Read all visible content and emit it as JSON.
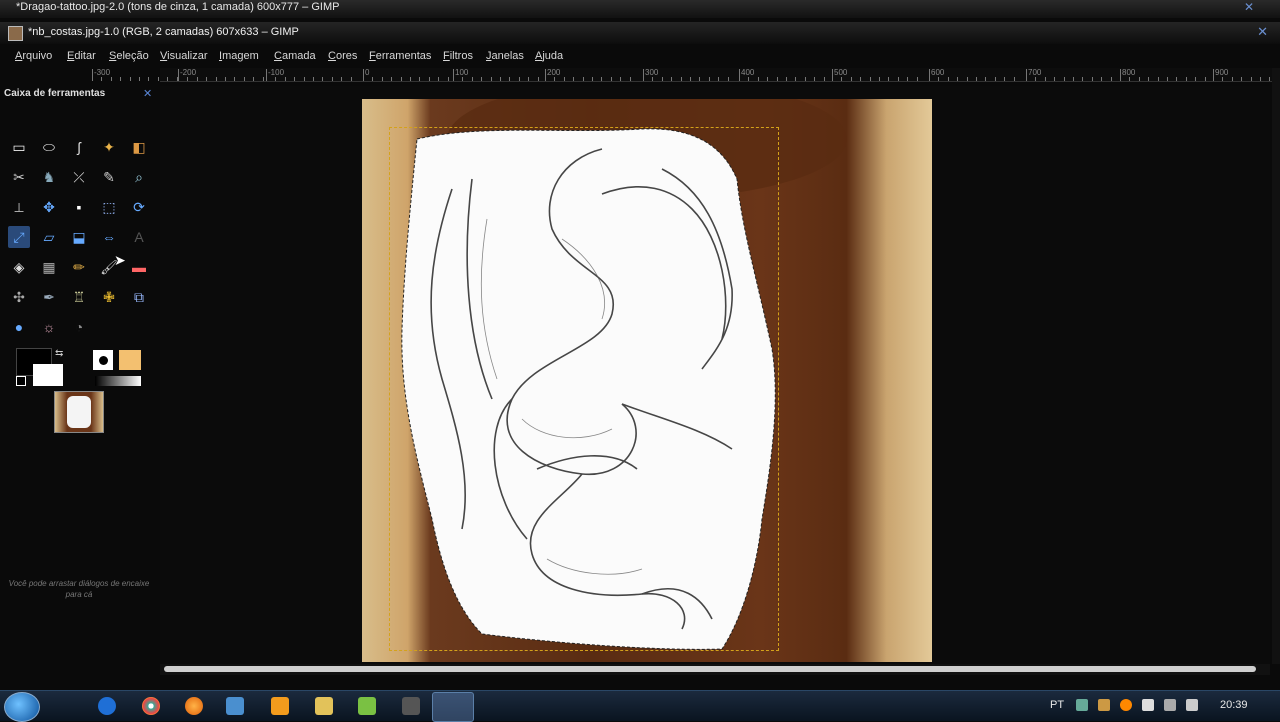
{
  "background_window": {
    "title": "*Dragao-tattoo.jpg-2.0 (tons de cinza, 1 camada) 600x777 – GIMP"
  },
  "window": {
    "title": "*nb_costas.jpg-1.0 (RGB, 2 camadas) 607x633 – GIMP"
  },
  "menu": [
    "Arquivo",
    "Editar",
    "Seleção",
    "Visualizar",
    "Imagem",
    "Camada",
    "Cores",
    "Ferramentas",
    "Filtros",
    "Janelas",
    "Ajuda"
  ],
  "ruler_labels": [
    "-300",
    "-200",
    "-100",
    "0",
    "100",
    "200",
    "300",
    "400",
    "500",
    "600",
    "700",
    "800",
    "900"
  ],
  "toolbox": {
    "title": "Caixa de ferramentas",
    "hint": "Você pode arrastar diálogos de encaixe para cá",
    "tools": [
      "rect-select-icon",
      "ellipse-select-icon",
      "free-select-icon",
      "fuzzy-select-icon",
      "color-select-icon",
      "scissors-select-icon",
      "foreground-select-icon",
      "paths-icon",
      "color-picker-icon",
      "zoom-icon",
      "measure-icon",
      "move-icon",
      "align-icon",
      "crop-icon",
      "rotate-icon",
      "scale-icon",
      "shear-icon",
      "perspective-icon",
      "flip-icon",
      "text-icon",
      "bucket-fill-icon",
      "blend-icon",
      "pencil-icon",
      "paintbrush-icon",
      "eraser-icon",
      "airbrush-icon",
      "ink-icon",
      "clone-icon",
      "heal-icon",
      "perspective-clone-icon",
      "blur-icon",
      "smudge-icon",
      "dodge-burn-icon"
    ]
  },
  "taskbar": {
    "lang": "PT",
    "clock": "20:39"
  },
  "colors": {
    "accent": "#5a86d6",
    "selection": "#d4a21a",
    "skin": "#6a3518",
    "wall": "#d8bd8a"
  }
}
